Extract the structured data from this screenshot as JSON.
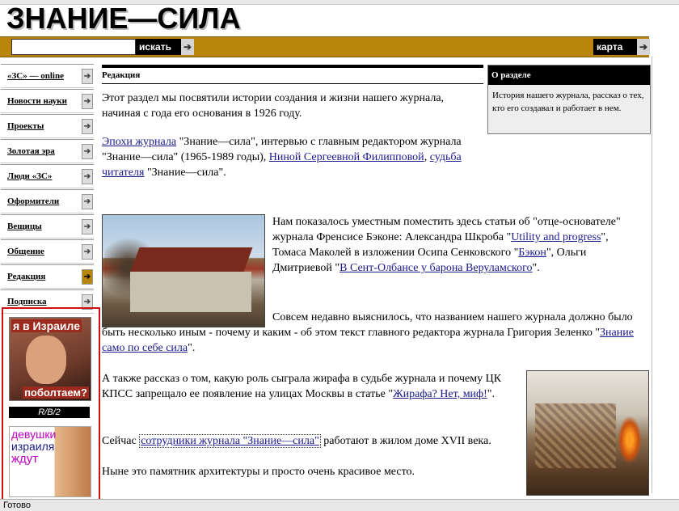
{
  "header": {
    "logo": "ЗНАНИЕ—СИЛА",
    "search_button": "искать",
    "map_button": "карта"
  },
  "nav": {
    "items": [
      {
        "label": "«ЗС» — online"
      },
      {
        "label": "Новости науки"
      },
      {
        "label": "Проекты"
      },
      {
        "label": "Золотая эра"
      },
      {
        "label": "Люди «ЗС»"
      },
      {
        "label": "Оформители"
      },
      {
        "label": "Вещицы"
      },
      {
        "label": "Общение"
      },
      {
        "label": "Редакция"
      },
      {
        "label": "Подписка"
      }
    ]
  },
  "ads": {
    "ad1_top": "я в Израиле",
    "ad1_bottom": "поболтаем?",
    "rb2": "R/B/2",
    "ad2_line1": "девушки",
    "ad2_line2": "израиля",
    "ad2_line3": "ждут"
  },
  "section": {
    "title": "Редакция"
  },
  "about": {
    "title": "О разделе",
    "text": "История нашего журнала, рассказ о тех, кто его создавал и работает в нем."
  },
  "content": {
    "intro": "Этот раздел мы посвятили истории создания и жизни нашего журнала, начиная с года его основания в 1926 году.",
    "p2_link1": "Эпохи журнала",
    "p2_t1": " \"Знание—сила\", интервью с главным редактором журнала \"Знание—сила\" (1965-1989 годы), ",
    "p2_link2": "Ниной Сергеевной Филипповой",
    "p2_t2": ", ",
    "p2_link3": "судьба читателя",
    "p2_t3": " \"Знание—сила\".",
    "p3_t1": "Нам показалось уместным поместить здесь статьи об \"отце-основателе\" журнала Френсисе Бэконе: Александра Шкроба \"",
    "p3_link1": "Utility and progress",
    "p3_t2": "\", Томаса Маколей в изложении Осипа Сенковского \"",
    "p3_link2": "Бэкон",
    "p3_t3": "\", Ольги Дмитриевой \"",
    "p3_link3": "В Сент-Олбансе у барона Веруламского",
    "p3_t4": "\".",
    "p4_t1": "Совсем недавно выяснилось, что названием нашего журнала должно было быть несколько иным - почему и каким - об этом текст главного редактора журнала Григория Зеленко \"",
    "p4_link1": "Знание само по себе сила",
    "p4_t2": "\".",
    "p5_t1": "А также рассказ о том, какую роль сыграла жирафа в судьбе журнала и почему ЦК КПСС запрещало ее появление на улицах Москвы в статье \"",
    "p5_link1": "Жирафа? Нет, миф!",
    "p5_t2": "\".",
    "p6_t1": "Сейчас ",
    "p6_link1": "сотрудники журнала \"Знание—сила\"",
    "p6_t2": " работают в жилом доме XVII века.",
    "p7": "Ныне это памятник архитектуры и просто очень красивое место."
  },
  "status": {
    "text": "Готово"
  },
  "icons": {
    "arrow": "arrow-right-icon"
  }
}
